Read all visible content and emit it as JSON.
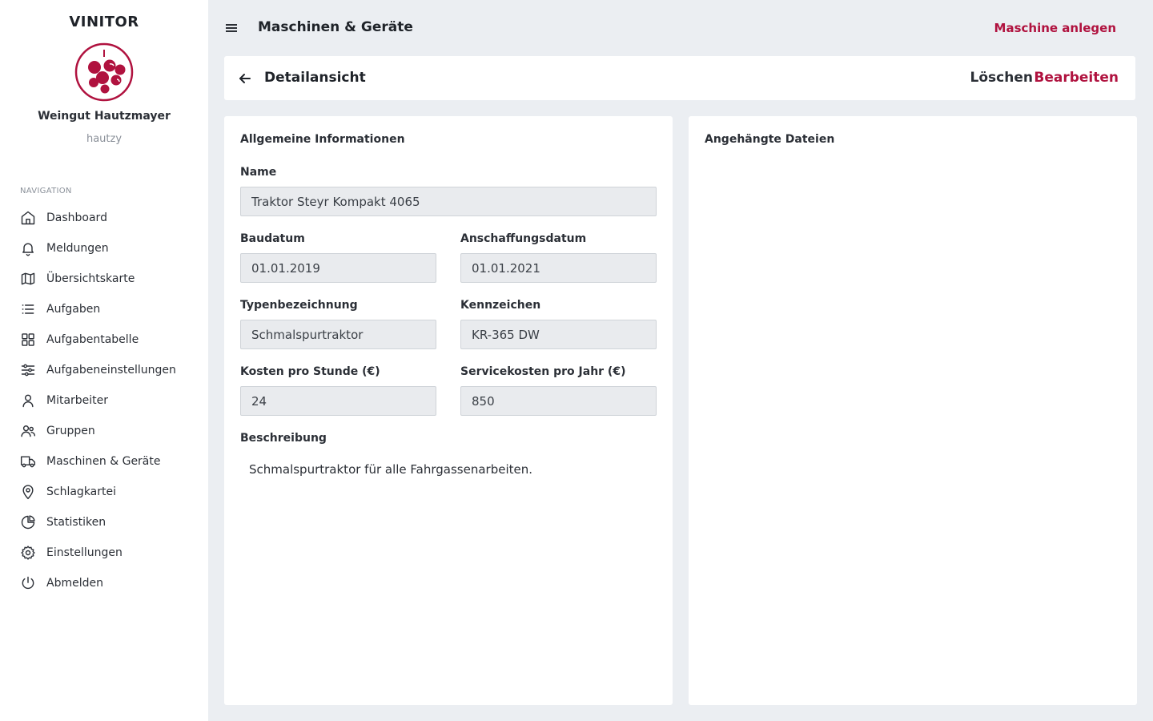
{
  "brand": "VINITOR",
  "org": {
    "name": "Weingut Hautzmayer",
    "user": "hautzy"
  },
  "nav": {
    "heading": "NAVIGATION",
    "items": [
      {
        "label": "Dashboard",
        "icon": "home-icon"
      },
      {
        "label": "Meldungen",
        "icon": "bell-icon"
      },
      {
        "label": "Übersichtskarte",
        "icon": "map-icon"
      },
      {
        "label": "Aufgaben",
        "icon": "list-icon"
      },
      {
        "label": "Aufgabentabelle",
        "icon": "grid-icon"
      },
      {
        "label": "Aufgabeneinstellungen",
        "icon": "sliders-icon"
      },
      {
        "label": "Mitarbeiter",
        "icon": "user-icon"
      },
      {
        "label": "Gruppen",
        "icon": "users-icon"
      },
      {
        "label": "Maschinen & Geräte",
        "icon": "truck-icon"
      },
      {
        "label": "Schlagkartei",
        "icon": "map-pin-icon"
      },
      {
        "label": "Statistiken",
        "icon": "pie-chart-icon"
      },
      {
        "label": "Einstellungen",
        "icon": "gear-icon"
      },
      {
        "label": "Abmelden",
        "icon": "power-icon"
      }
    ]
  },
  "header": {
    "title": "Maschinen & Geräte",
    "add_label": "Maschine anlegen"
  },
  "detail": {
    "title": "Detailansicht",
    "delete_label": "Löschen",
    "edit_label": "Bearbeiten"
  },
  "info": {
    "title": "Allgemeine Informationen",
    "name_label": "Name",
    "name_value": "Traktor Steyr Kompakt 4065",
    "build_label": "Baudatum",
    "build_value": "01.01.2019",
    "purchase_label": "Anschaffungsdatum",
    "purchase_value": "01.01.2021",
    "type_label": "Typenbezeichnung",
    "type_value": "Schmalspurtraktor",
    "plate_label": "Kennzeichen",
    "plate_value": "KR-365 DW",
    "hourly_label": "Kosten pro Stunde (€)",
    "hourly_value": "24",
    "service_label": "Servicekosten pro Jahr (€)",
    "service_value": "850",
    "description_label": "Beschreibung",
    "description_value": "Schmalspurtraktor für alle Fahrgassenarbeiten."
  },
  "files": {
    "title": "Angehängte Dateien"
  },
  "colors": {
    "accent": "#b0123f",
    "background": "#ebeef2",
    "input_bg": "#e9ebee"
  }
}
